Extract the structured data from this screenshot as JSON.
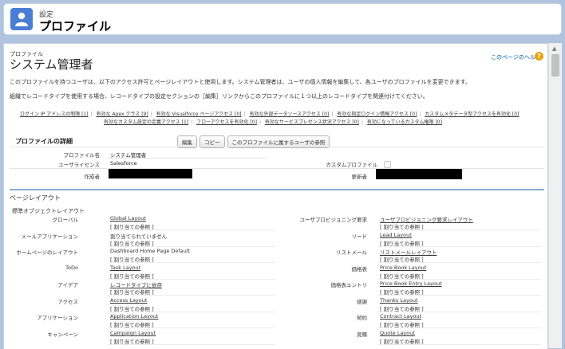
{
  "header": {
    "small": "設定",
    "title": "プロファイル"
  },
  "page": {
    "type": "プロファイル",
    "title": "システム管理者",
    "help_link": "このページのヘルプ",
    "description1": "このプロファイルを持つユーザは、以下のアクセス許可とページレイアウトと使用します。システム管理者は、ユーザの個人情報を編集して、各ユーザのプロファイルを変更できます。",
    "description2": "組織でレコードタイプを使用する場合、レコードタイプの設定セクションの［編集］リンクからこのプロファイルに１つ以上のレコードタイプを関連付けてください。"
  },
  "links_row1": [
    "ログイン IP アドレスの制限 [1]",
    "有効な Apex クラス [9]",
    "有効な Visualforce ページアクセス [0]",
    "有効な外部データソースアクセス [0]",
    "有効な指定ログイン情報アクセス [0]",
    "カスタムメタデータ型アクセスを有効化 [0]"
  ],
  "links_row2": [
    "有効なカスタム設定の定義アクセス [1]",
    "フローアクセスを有効化 [0]",
    "有効なサービスプレゼンス状況アクセス [0]",
    "有効になっているカスタム権限 [0]"
  ],
  "details": {
    "title": "プロファイルの詳細",
    "buttons": [
      "編集",
      "コピー",
      "このプロファイルに属するユーザの参照"
    ],
    "profile_name_label": "プロファイル名",
    "profile_name": "システム管理者",
    "license_label": "ユーザライセンス",
    "license": "Salesforce",
    "custom_label": "カスタムプロファイル",
    "created_label": "作成者",
    "modified_label": "更新者"
  },
  "layouts": {
    "title": "ページレイアウト",
    "subtitle": "標準オブジェクトレイアウト",
    "assign_label": "割り当ての参照",
    "left": [
      {
        "label": "グローバル",
        "layout": "Global Layout",
        "link": true
      },
      {
        "label": "メールアプリケーション",
        "layout": "割り当てられていません",
        "link": false
      },
      {
        "label": "ホームページのレイアウト",
        "layout": "Dashboard Home Page Default",
        "link": false
      },
      {
        "label": "ToDo",
        "layout": "Task Layout",
        "link": true
      },
      {
        "label": "アイデア",
        "layout": "レコードタイプに依存",
        "link": true
      },
      {
        "label": "アクセス",
        "layout": "Access Layout",
        "link": true
      },
      {
        "label": "アプリケーション",
        "layout": "Application Layout",
        "link": true
      },
      {
        "label": "キャンペーン",
        "layout": "Campaign Layout",
        "link": true
      }
    ],
    "right": [
      {
        "label": "ユーザプロビジョニング要求",
        "layout": "ユーザプロビジョニング要求レイアウト"
      },
      {
        "label": "リード",
        "layout": "Lead Layout"
      },
      {
        "label": "リストメール",
        "layout": "リストメールレイアウト"
      },
      {
        "label": "価格表",
        "layout": "Price Book Layout"
      },
      {
        "label": "価格表エントリ",
        "layout": "Price Book Entry Layout"
      },
      {
        "label": "感謝",
        "layout": "Thanks Layout"
      },
      {
        "label": "契約",
        "layout": "Contract Layout"
      },
      {
        "label": "見積",
        "layout": "Quote Layout"
      }
    ]
  }
}
